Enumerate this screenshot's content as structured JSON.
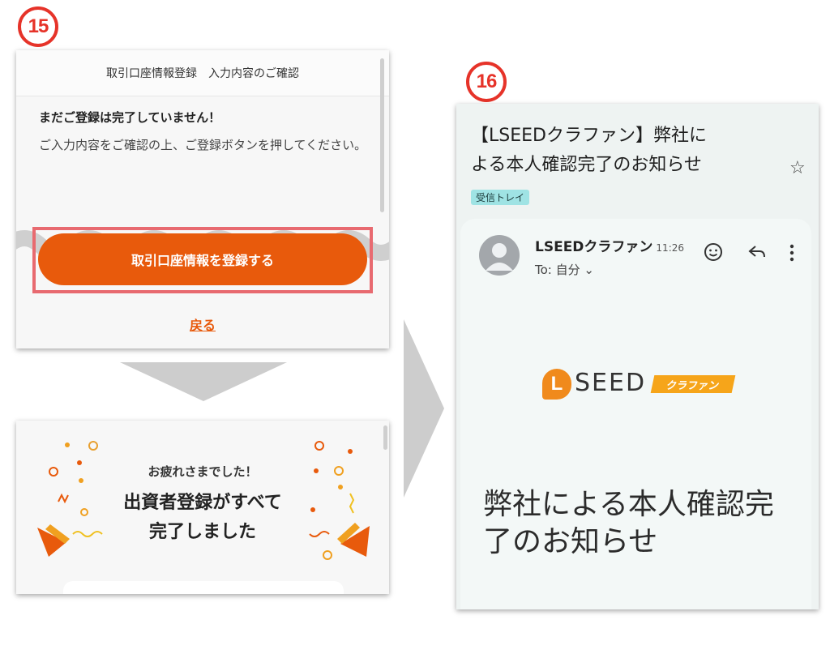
{
  "steps": {
    "step15": "15",
    "step16": "16"
  },
  "panel15": {
    "header_title": "取引口座情報登録　入力内容のご確認",
    "warning": "まだご登録は完了していません！",
    "instruction": "ご入力内容をご確認の上、ご登録ボタンを押してください。",
    "register_button": "取引口座情報を登録する",
    "back_link": "戻る"
  },
  "completion": {
    "small_title": "お疲れさまでした！",
    "big_title_line1": "出資者登録がすべて",
    "big_title_line2": "完了しました"
  },
  "email": {
    "subject_line1": "【LSEEDクラファン】弊社に",
    "subject_line2": "よる本人確認完了のお知らせ",
    "label_chip": "受信トレイ",
    "sender_name": "LSEEDクラファン",
    "time": "11:26",
    "to_line": "To: 自分 ⌄",
    "logo_letter": "L",
    "logo_text": "SEED",
    "logo_tag": "クラファン",
    "headline_line1": "弊社による本人確認完",
    "headline_line2": "了のお知らせ",
    "icons": [
      "star-icon",
      "smile-icon",
      "reply-icon",
      "more-vert-icon",
      "avatar-icon"
    ]
  },
  "colors": {
    "accent_orange": "#e85a0c",
    "highlight_frame": "#e86a70",
    "step_badge": "#e63329",
    "chip_bg": "#9fe3e4",
    "logo_orange": "#f08a1c"
  }
}
